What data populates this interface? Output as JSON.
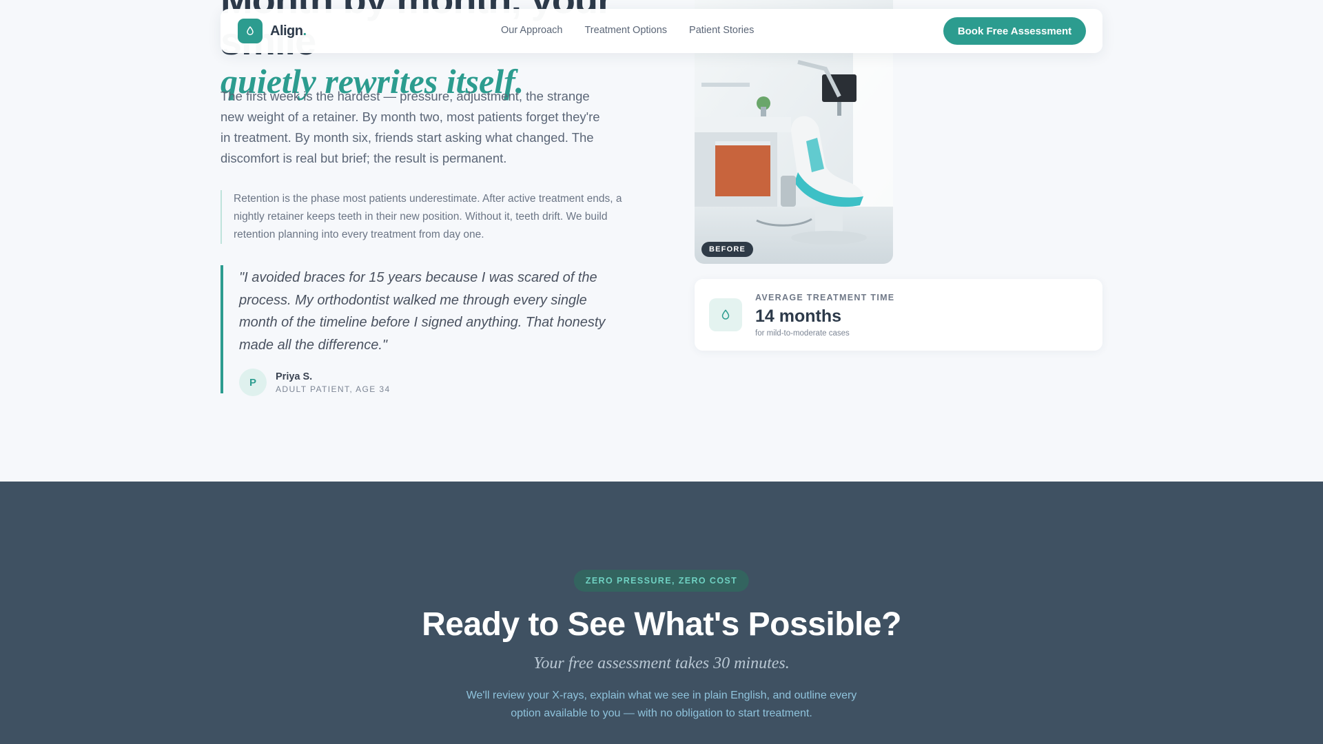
{
  "nav": {
    "brand": "Align",
    "brand_dot": ".",
    "links": [
      "Our Approach",
      "Treatment Options",
      "Patient Stories"
    ],
    "cta_label": "Book Free Assessment",
    "logo_icon": "tooth-icon"
  },
  "story": {
    "heading_line1": "Month by month, your smile",
    "heading_line2": "quietly rewrites itself.",
    "paragraph": "The first week is the hardest — pressure, adjustment, the strange new weight of a retainer. By month two, most patients forget they're in treatment. By month six, friends start asking what changed. The discomfort is real but brief; the result is permanent.",
    "note": "Retention is the phase most patients underestimate. After active treatment ends, a nightly retainer keeps teeth in their new position. Without it, teeth drift. We build retention planning into every treatment from day one.",
    "quote": "\"I avoided braces for 15 years because I was scared of the process. My orthodontist walked me through every single month of the timeline before I signed anything. That honesty made all the difference.\"",
    "author_initial": "P",
    "author_name": "Priya S.",
    "author_role": "ADULT PATIENT, AGE 34"
  },
  "photo": {
    "badge": "BEFORE"
  },
  "stat": {
    "label": "AVERAGE TREATMENT TIME",
    "value": "14 months",
    "sub": "for mild-to-moderate cases",
    "icon": "tooth-icon"
  },
  "cta_section": {
    "pill": "ZERO PRESSURE, ZERO COST",
    "title": "Ready to See What's Possible?",
    "subtitle": "Your free assessment takes 30 minutes.",
    "description": "We'll review your X-rays, explain what we see in plain English, and outline every option available to you — with no obligation to start treatment."
  },
  "colors": {
    "accent": "#2c9c8f",
    "dark_section": "#3f5162",
    "heading": "#2d3a4a"
  }
}
